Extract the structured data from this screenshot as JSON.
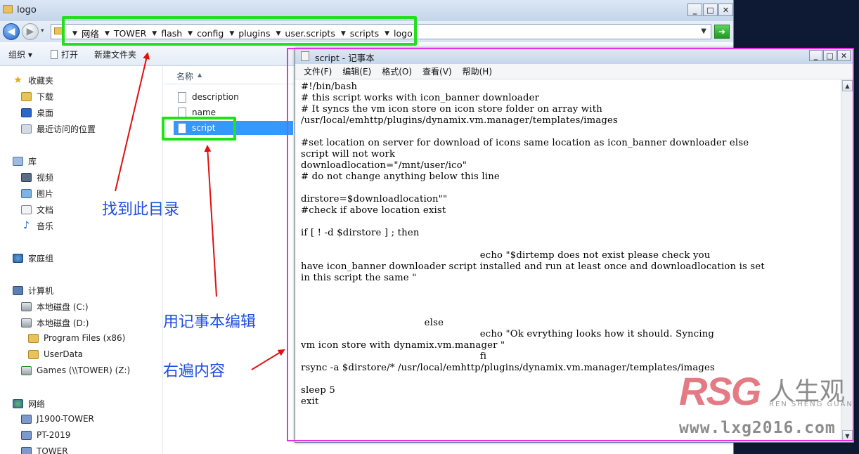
{
  "explorer": {
    "title": "logo",
    "breadcrumb": [
      "网络",
      "TOWER",
      "flash",
      "config",
      "plugins",
      "user.scripts",
      "scripts",
      "logo"
    ],
    "toolbar": {
      "organize": "组织 ▾",
      "open": "打开",
      "new_folder": "新建文件夹"
    },
    "sidebar": {
      "favorites": "收藏夹",
      "fav_items": [
        "下载",
        "桌面",
        "最近访问的位置"
      ],
      "libraries": "库",
      "lib_items": [
        "视频",
        "图片",
        "文档",
        "音乐"
      ],
      "homegroup": "家庭组",
      "computer": "计算机",
      "drives": [
        "本地磁盘 (C:)",
        "本地磁盘 (D:)"
      ],
      "d_folders": [
        "Program Files (x86)",
        "UserData"
      ],
      "net_drive": "Games (\\\\TOWER) (Z:)",
      "network": "网络",
      "net_hosts": [
        "J1900-TOWER",
        "PT-2019",
        "TOWER"
      ]
    },
    "columns": {
      "name": "名称"
    },
    "files": [
      "description",
      "name",
      "script"
    ],
    "selected_file": "script"
  },
  "notepad": {
    "title": "script - 记事本",
    "menu": [
      "文件(F)",
      "编辑(E)",
      "格式(O)",
      "查看(V)",
      "帮助(H)"
    ],
    "content": "#!/bin/bash\n# this script works with icon_banner downloader\n# It syncs the vm icon store on icon store folder on array with\n/usr/local/emhttp/plugins/dynamix.vm.manager/templates/images\n\n#set location on server for download of icons same location as icon_banner downloader else\nscript will not work\ndownloadlocation=\"/mnt/user/ico\"\n# do not change anything below this line\n\ndirstore=$downloadlocation\"\"\n#check if above location exist\n\nif [ ! -d $dirstore ] ; then\n\n                                                          echo \"$dirtemp does not exist please check you\nhave icon_banner downloader script installed and run at least once and downloadlocation is set\nin this script the same \"\n\n\n\n                                        else\n                                                          echo \"Ok evrything looks how it should. Syncing\nvm icon store with dynamix.vm.manager \"\n                                                          fi\nrsync -a $dirstore/* /usr/local/emhttp/plugins/dynamix.vm.manager/templates/images\n\nsleep 5\nexit"
  },
  "annotations": {
    "find_dir": "找到此目录",
    "edit_notepad": "用记事本编辑",
    "right_content": "右遍内容"
  },
  "watermark": {
    "brand": "RSG",
    "cn": "人生观",
    "sub": "REN SHENG GUAN",
    "url": "www.lxg2016.com"
  },
  "colors": {
    "highlight_green": "#22e01b",
    "highlight_magenta": "#e62ee6",
    "annotation_blue": "#1f4fe0",
    "arrow_red": "#e01010",
    "selection_blue": "#3399ff"
  }
}
